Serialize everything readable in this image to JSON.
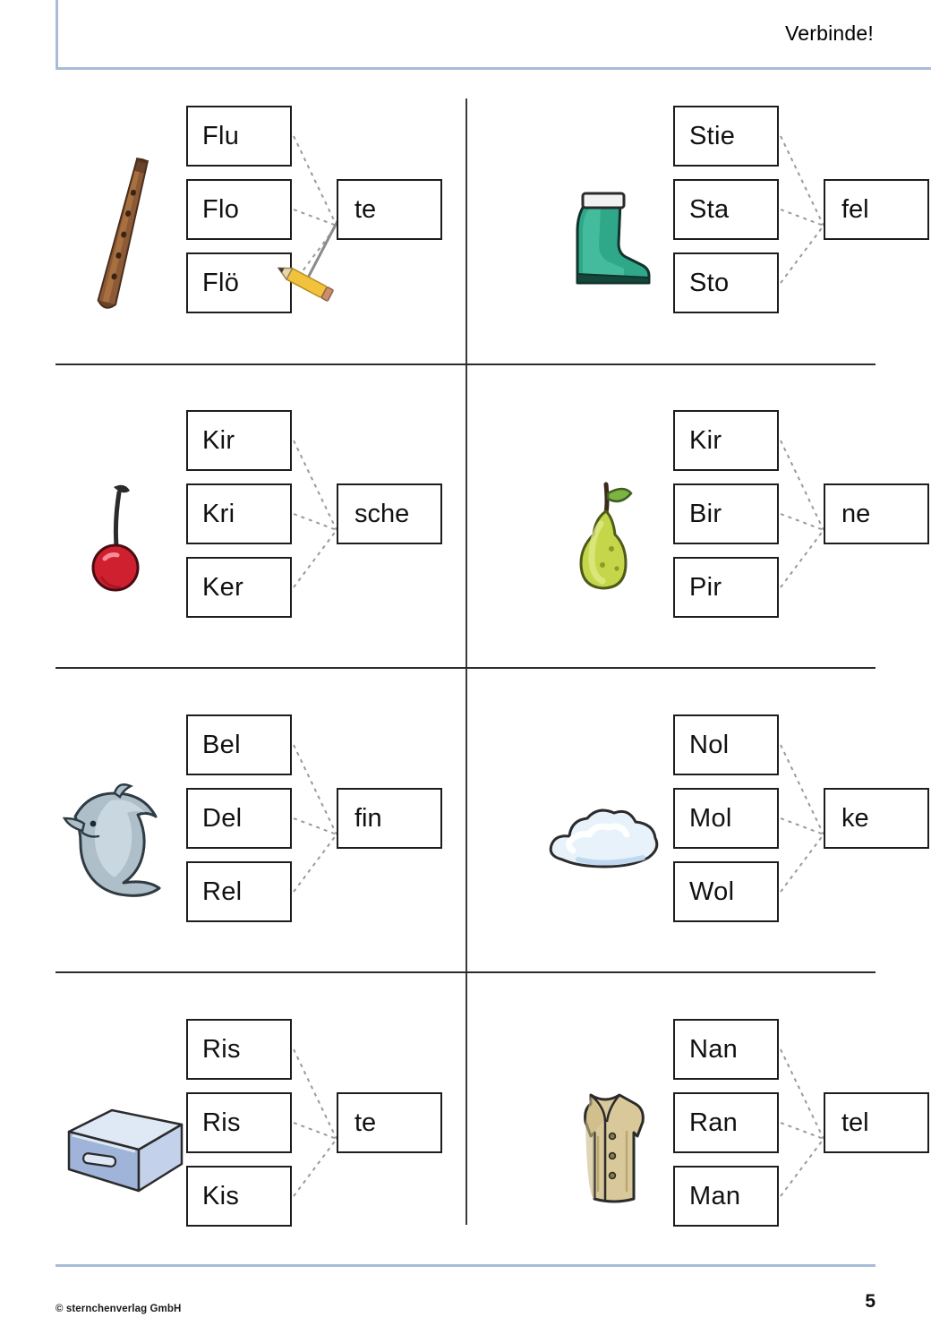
{
  "header": {
    "title": "Verbinde!"
  },
  "footer": {
    "copyright": "© sternchenverlag GmbH",
    "page_number": "5"
  },
  "exercises": [
    {
      "picture": "recorder-flute-icon",
      "picture_label": "Blockflöte",
      "syllables": [
        "Flu",
        "Flo",
        "Flö"
      ],
      "ending": "te",
      "solution_index": 2
    },
    {
      "picture": "rubber-boot-icon",
      "picture_label": "Stiefel",
      "syllables": [
        "Stie",
        "Sta",
        "Sto"
      ],
      "ending": "fel",
      "solution_index": 0
    },
    {
      "picture": "cherry-icon",
      "picture_label": "Kirsche",
      "syllables": [
        "Kir",
        "Kri",
        "Ker"
      ],
      "ending": "sche",
      "solution_index": 0
    },
    {
      "picture": "pear-icon",
      "picture_label": "Birne",
      "syllables": [
        "Kir",
        "Bir",
        "Pir"
      ],
      "ending": "ne",
      "solution_index": 1
    },
    {
      "picture": "dolphin-icon",
      "picture_label": "Delfin",
      "syllables": [
        "Bel",
        "Del",
        "Rel"
      ],
      "ending": "fin",
      "solution_index": 1
    },
    {
      "picture": "cloud-icon",
      "picture_label": "Wolke",
      "syllables": [
        "Nol",
        "Mol",
        "Wol"
      ],
      "ending": "ke",
      "solution_index": 2
    },
    {
      "picture": "box-crate-icon",
      "picture_label": "Kiste",
      "syllables": [
        "Ris",
        "Ris",
        "Kis"
      ],
      "ending": "te",
      "solution_index": 2
    },
    {
      "picture": "coat-icon",
      "picture_label": "Mantel",
      "syllables": [
        "Nan",
        "Ran",
        "Man"
      ],
      "ending": "tel",
      "solution_index": 2
    }
  ],
  "colors": {
    "frame": "#a8bcd8",
    "box_border": "#1d1d1d",
    "divider": "#2b2b2b",
    "connector": "#9a9a9a",
    "pencil_line": "#7a7a7a"
  }
}
